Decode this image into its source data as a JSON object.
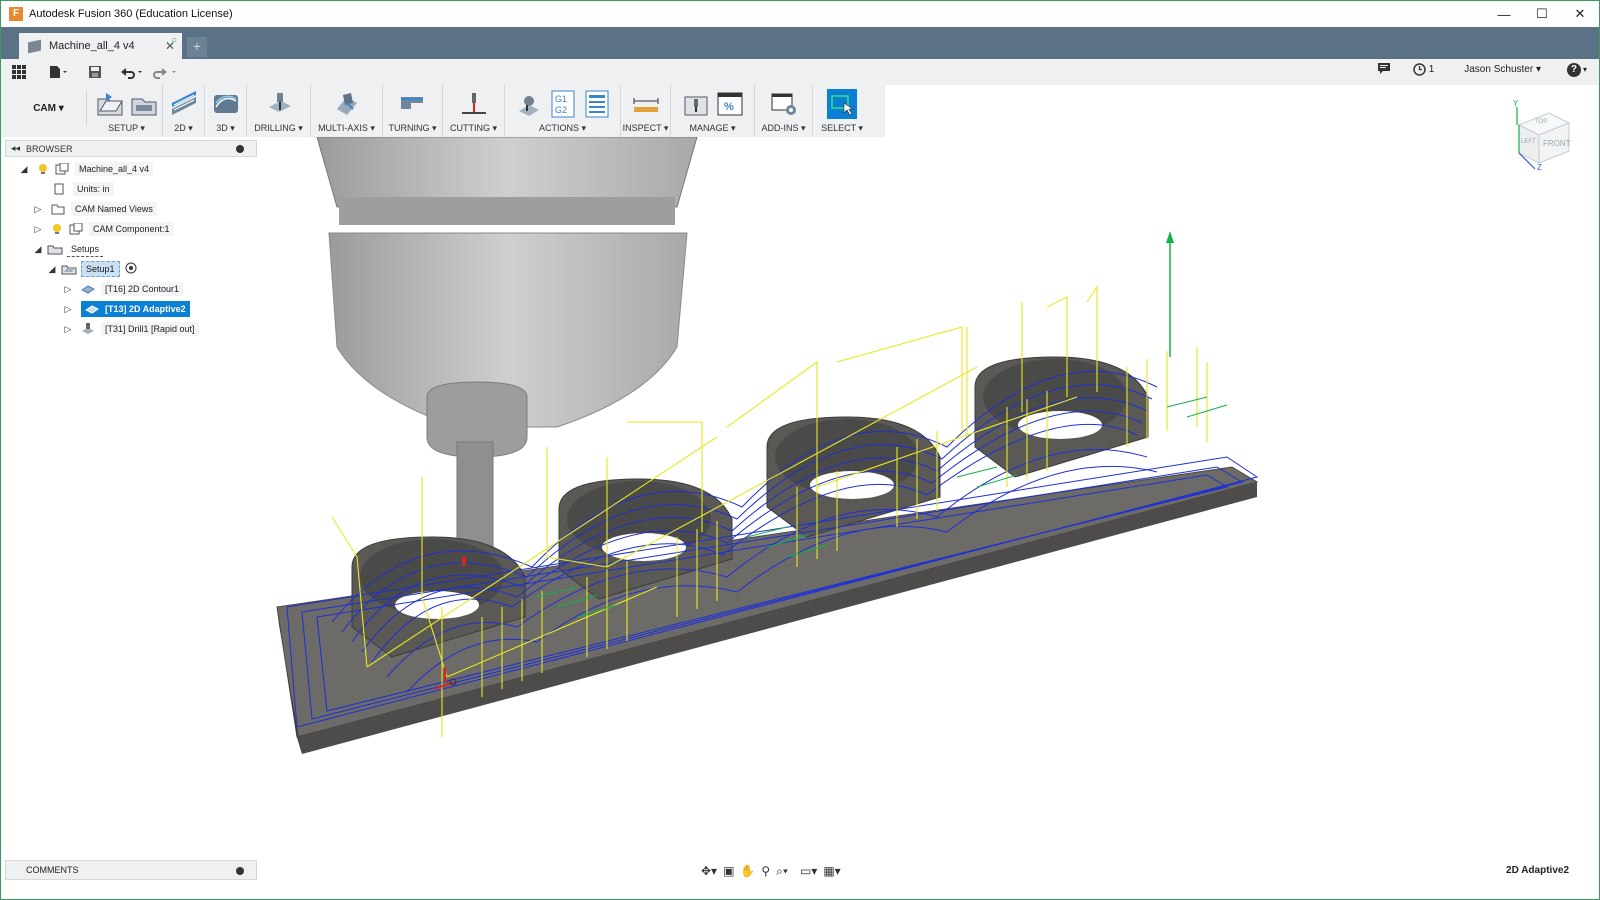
{
  "window": {
    "title": "Autodesk Fusion 360 (Education License)",
    "app_icon": "F",
    "minimize": "—",
    "maximize": "☐",
    "close": "✕"
  },
  "tabs": {
    "doc_label": "Machine_all_4 v4",
    "new_tab": "+"
  },
  "qat": {
    "user": "Jason Schuster ▾",
    "jobs_count": "1",
    "help": "?"
  },
  "toolbar": {
    "workspace": "CAM ▾",
    "groups": {
      "setup": "SETUP ▾",
      "g2d": "2D ▾",
      "g3d": "3D ▾",
      "drilling": "DRILLING ▾",
      "multiaxis": "MULTI-AXIS ▾",
      "turning": "TURNING ▾",
      "cutting": "CUTTING ▾",
      "actions": "ACTIONS ▾",
      "inspect": "INSPECT ▾",
      "manage": "MANAGE ▾",
      "addins": "ADD-INS ▾",
      "select": "SELECT ▾"
    },
    "gcode_icon": "G1 G2",
    "percent_icon": "%"
  },
  "browser": {
    "header": "BROWSER",
    "items": [
      {
        "label": "Machine_all_4 v4"
      },
      {
        "label": "Units: in"
      },
      {
        "label": "CAM Named Views"
      },
      {
        "label": "CAM Component:1"
      },
      {
        "label": "Setups"
      },
      {
        "label": "Setup1"
      },
      {
        "label": "[T16] 2D Contour1"
      },
      {
        "label": "[T13] 2D Adaptive2"
      },
      {
        "label": "[T31] Drill1 [Rapid out]"
      }
    ]
  },
  "viewcube": {
    "front": "FRONT",
    "left": "LEFT",
    "top": "TOP",
    "axis_y": "Y",
    "axis_z": "Z"
  },
  "comments": {
    "label": "COMMENTS"
  },
  "statusbar": {
    "active_operation": "2D Adaptive2"
  },
  "colors": {
    "tab_strip": "#5a7186",
    "selected": "#0a7fd4",
    "toolpath_feed": "#1f2fd6",
    "toolpath_rapid": "#e8e820",
    "toolpath_link": "#12b24a",
    "stock": "#5e5d5a"
  }
}
